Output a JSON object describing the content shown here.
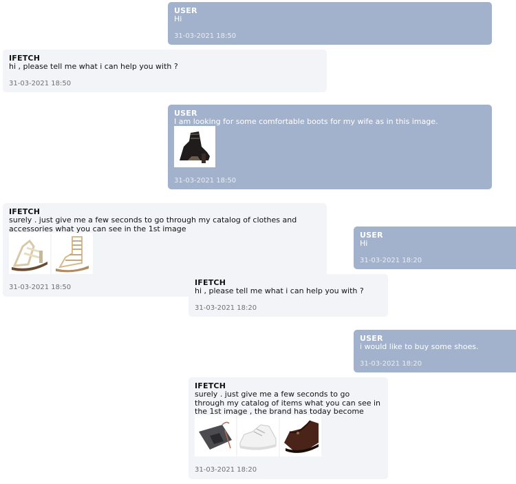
{
  "messages": [
    {
      "sender": "USER",
      "text": "Hi",
      "time": "31-03-2021 18:50"
    },
    {
      "sender": "IFETCH",
      "text": "hi , please tell me what i can help you with ?",
      "time": "31-03-2021 18:50"
    },
    {
      "sender": "USER",
      "text": "I am looking for some comfortable boots for my wife as in this image.",
      "time": "31-03-2021 18:50",
      "images": [
        {
          "icon": "black-heeled-sandal-image"
        }
      ]
    },
    {
      "sender": "IFETCH",
      "text_lines": [
        "surely . just give me a few seconds to go through my catalog of clothes and",
        "accessories what you can see in the 1st image"
      ],
      "time": "31-03-2021 18:50",
      "images": [
        {
          "icon": "beige-strappy-sandal-image"
        },
        {
          "icon": "tan-gladiator-sandal-image"
        }
      ]
    },
    {
      "sender": "USER",
      "text": "Hi",
      "time": "31-03-2021 18:20"
    },
    {
      "sender": "IFETCH",
      "text": "hi , please tell me what i can help you with ?",
      "time": "31-03-2021 18:20"
    },
    {
      "sender": "USER",
      "text": "i would like to buy some shoes.",
      "time": "31-03-2021 18:20"
    },
    {
      "sender": "IFETCH",
      "text_lines": [
        "surely . just give me a few seconds to go",
        "through my catalog of items what you can see in",
        "the 1st image , the brand has today become"
      ],
      "time": "31-03-2021 18:20",
      "images": [
        {
          "icon": "shoe-bag-image"
        },
        {
          "icon": "white-sneaker-image"
        },
        {
          "icon": "brown-mary-jane-shoe-image"
        }
      ]
    }
  ],
  "colors": {
    "user_bubble": "#a2b2cd",
    "bot_bubble": "#f3f4f7"
  }
}
